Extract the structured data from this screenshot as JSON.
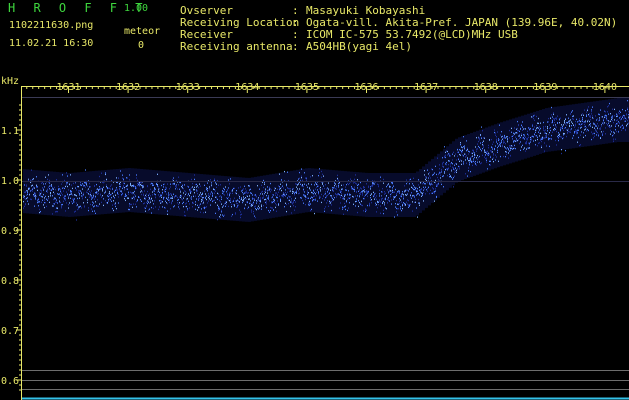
{
  "app": {
    "title": "H R O F F T",
    "version": "1.00"
  },
  "file": {
    "name": "1102211630.png",
    "datetime": "11.02.21 16:30"
  },
  "meteor": {
    "label": "meteor",
    "count": "0"
  },
  "info": [
    {
      "label": "Ovserver",
      "value": "Masayuki Kobayashi"
    },
    {
      "label": "Receiving Location",
      "value": "Ogata-vill. Akita-Pref. JAPAN (139.96E, 40.02N)"
    },
    {
      "label": "Receiver",
      "value": "ICOM IC-575 53.7492(@LCD)MHz USB"
    },
    {
      "label": "Receiving antenna",
      "value": "A504HB(yagi 4el)"
    }
  ],
  "separator": ":",
  "spectrogram": {
    "y_unit": "kHz",
    "x_ticks": [
      "1631",
      "1632",
      "1633",
      "1634",
      "1635",
      "1636",
      "1637",
      "1638",
      "1639",
      "1640"
    ],
    "y_ticks": [
      {
        "label": "1.1",
        "value": 1.1
      },
      {
        "label": "1.0",
        "value": 1.0
      },
      {
        "label": "0.9",
        "value": 0.9
      },
      {
        "label": "0.8",
        "value": 0.8
      },
      {
        "label": "0.7",
        "value": 0.7
      },
      {
        "label": "0.6",
        "value": 0.6
      }
    ],
    "signal_trace": [
      {
        "minute": 1630.0,
        "khz": 0.98
      },
      {
        "minute": 1631.0,
        "khz": 0.97
      },
      {
        "minute": 1632.0,
        "khz": 0.98
      },
      {
        "minute": 1633.0,
        "khz": 0.97
      },
      {
        "minute": 1634.0,
        "khz": 0.96
      },
      {
        "minute": 1635.0,
        "khz": 0.98
      },
      {
        "minute": 1636.0,
        "khz": 0.97
      },
      {
        "minute": 1636.8,
        "khz": 0.97
      },
      {
        "minute": 1637.5,
        "khz": 1.04
      },
      {
        "minute": 1638.2,
        "khz": 1.07
      },
      {
        "minute": 1639.0,
        "khz": 1.1
      },
      {
        "minute": 1640.2,
        "khz": 1.12
      }
    ],
    "colors": {
      "text": "#e8e868",
      "signal": "#4a7cff",
      "grid": "#6d6d6d",
      "accent_line": "#34c2e8"
    }
  }
}
